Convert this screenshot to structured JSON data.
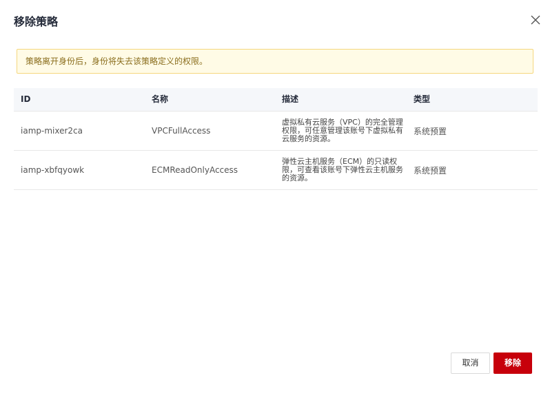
{
  "dialog": {
    "title": "移除策略",
    "close_icon": "close-icon"
  },
  "alert": {
    "text": "策略离开身份后，身份将失去该策略定义的权限。"
  },
  "table": {
    "headers": [
      "ID",
      "名称",
      "描述",
      "类型"
    ],
    "rows": [
      {
        "id": "iamp-mixer2ca",
        "name": "VPCFullAccess",
        "desc": "虚拟私有云服务（VPC）的完全管理权限，可任意管理该账号下虚拟私有云服务的资源。",
        "type": "系统预置"
      },
      {
        "id": "iamp-xbfqyowk",
        "name": "ECMReadOnlyAccess",
        "desc": "弹性云主机服务（ECM）的只读权限，可查看该账号下弹性云主机服务的资源。",
        "type": "系统预置"
      }
    ]
  },
  "footer": {
    "cancel_label": "取消",
    "remove_label": "移除"
  },
  "colors": {
    "alert_bg": "#fffbe6",
    "alert_border": "#f5d77d",
    "primary": "#c7000b",
    "header_bg": "#f5f7fa"
  }
}
